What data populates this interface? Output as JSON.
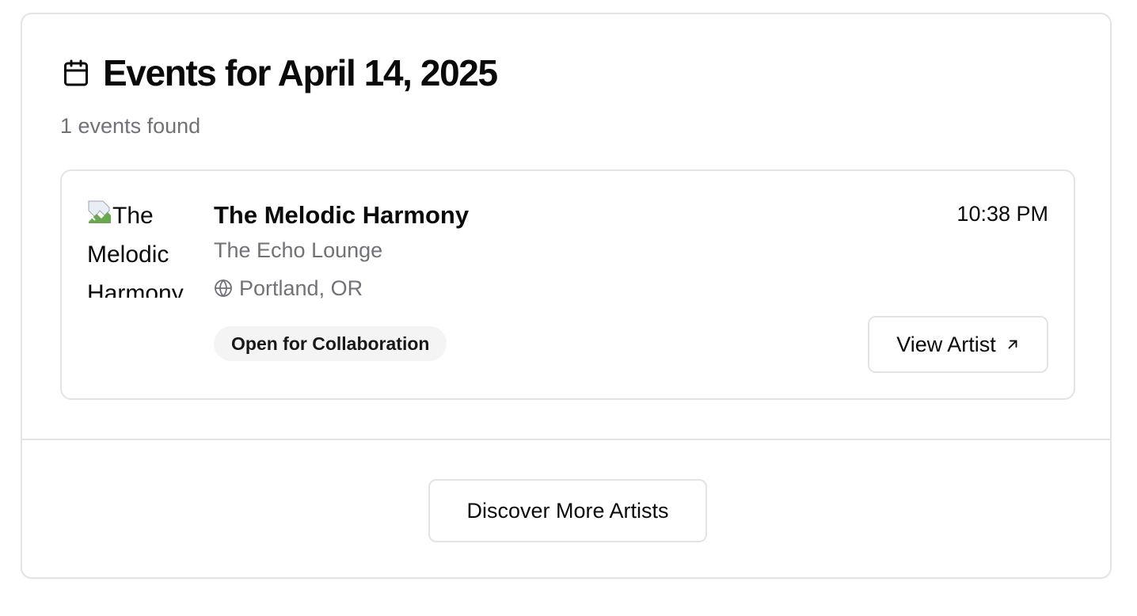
{
  "header": {
    "title": "Events for April 14, 2025",
    "subtitle": "1 events found",
    "icon": "calendar-icon"
  },
  "event": {
    "image_alt": "The Melodic Harmony",
    "artist_name": "The Melodic Harmony",
    "venue": "The Echo Lounge",
    "location": "Portland, OR",
    "location_icon": "globe-icon",
    "time": "10:38 PM",
    "badge": "Open for Collaboration",
    "view_button_label": "View Artist",
    "view_button_icon": "arrow-up-right-icon"
  },
  "footer": {
    "discover_button_label": "Discover More Artists"
  },
  "colors": {
    "text": "#0a0a0a",
    "muted": "#71717a",
    "border": "#e4e4e7",
    "badge_bg": "#f4f4f5"
  }
}
